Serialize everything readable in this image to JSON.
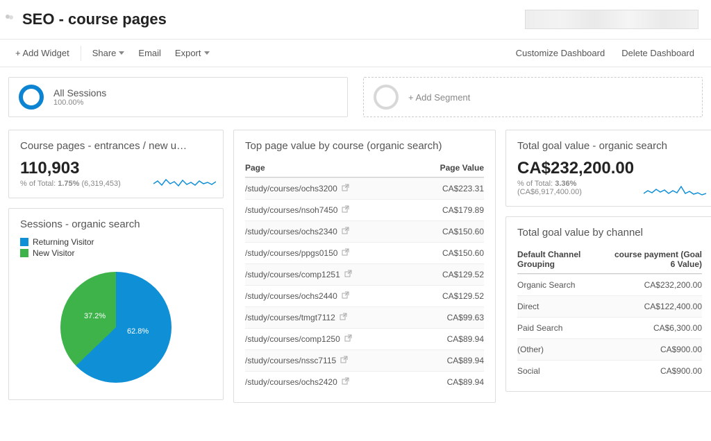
{
  "header": {
    "title": "SEO - course pages"
  },
  "toolbar": {
    "add_widget": "+ Add Widget",
    "share": "Share",
    "email": "Email",
    "export": "Export",
    "customize": "Customize Dashboard",
    "delete": "Delete Dashboard"
  },
  "segments": {
    "primary": {
      "title": "All Sessions",
      "sub": "100.00%"
    },
    "add_label": "+ Add Segment"
  },
  "widgets": {
    "entrances": {
      "title": "Course pages - entrances / new u…",
      "value": "110,903",
      "sub_prefix": "% of Total: ",
      "sub_pct": "1.75%",
      "sub_total": " (6,319,453)"
    },
    "sessions_pie": {
      "title": "Sessions - organic search",
      "legend": [
        {
          "label": "Returning Visitor",
          "color": "#0f8fd6"
        },
        {
          "label": "New Visitor",
          "color": "#3db34a"
        }
      ]
    },
    "top_pages": {
      "title": "Top page value by course (organic search)",
      "col_page": "Page",
      "col_value": "Page Value"
    },
    "goal_value": {
      "title": "Total goal value - organic search",
      "value": "CA$232,200.00",
      "sub_prefix": "% of Total: ",
      "sub_pct": "3.36%",
      "sub_total": "(CA$6,917,400.00)"
    },
    "channel": {
      "title": "Total goal value by channel",
      "col_channel": "Default Channel Grouping",
      "col_value": "course payment (Goal 6 Value)"
    }
  },
  "chart_data": {
    "type": "pie",
    "title": "Sessions - organic search",
    "series": [
      {
        "name": "Returning Visitor",
        "value": 62.8,
        "color": "#0f8fd6"
      },
      {
        "name": "New Visitor",
        "value": 37.2,
        "color": "#3db34a"
      }
    ]
  },
  "top_pages_rows": [
    {
      "page": "/study/courses/ochs3200",
      "value": "CA$223.31"
    },
    {
      "page": "/study/courses/nsoh7450",
      "value": "CA$179.89"
    },
    {
      "page": "/study/courses/ochs2340",
      "value": "CA$150.60"
    },
    {
      "page": "/study/courses/ppgs0150",
      "value": "CA$150.60"
    },
    {
      "page": "/study/courses/comp1251",
      "value": "CA$129.52"
    },
    {
      "page": "/study/courses/ochs2440",
      "value": "CA$129.52"
    },
    {
      "page": "/study/courses/tmgt7112",
      "value": "CA$99.63"
    },
    {
      "page": "/study/courses/comp1250",
      "value": "CA$89.94"
    },
    {
      "page": "/study/courses/nssc7115",
      "value": "CA$89.94"
    },
    {
      "page": "/study/courses/ochs2420",
      "value": "CA$89.94"
    }
  ],
  "channel_rows": [
    {
      "channel": "Organic Search",
      "value": "CA$232,200.00"
    },
    {
      "channel": "Direct",
      "value": "CA$122,400.00"
    },
    {
      "channel": "Paid Search",
      "value": "CA$6,300.00"
    },
    {
      "channel": "(Other)",
      "value": "CA$900.00"
    },
    {
      "channel": "Social",
      "value": "CA$900.00"
    }
  ],
  "colors": {
    "blue": "#0f8fd6",
    "green": "#3db34a"
  }
}
